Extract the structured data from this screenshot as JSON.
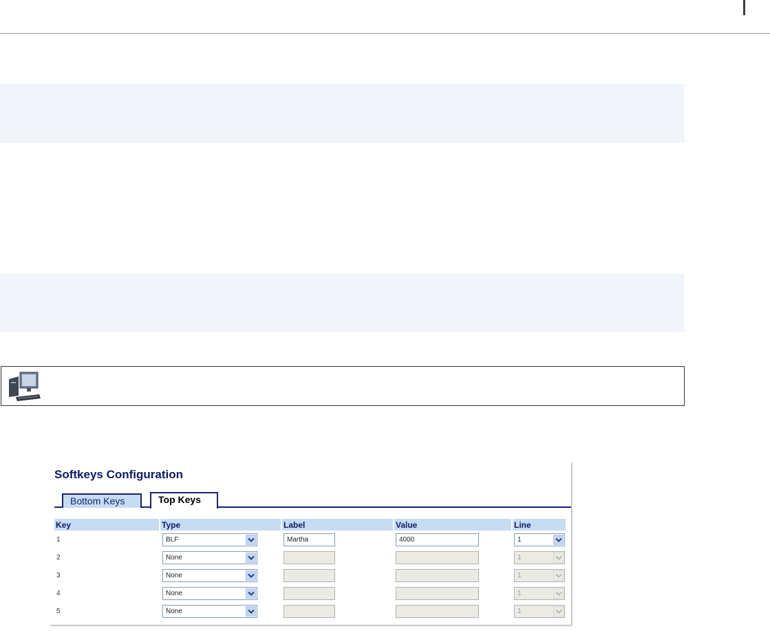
{
  "panel": {
    "title": "Softkeys Configuration",
    "tabs": [
      {
        "label": "Bottom Keys",
        "active": false
      },
      {
        "label": "Top Keys",
        "active": true
      }
    ],
    "columns": [
      "Key",
      "Type",
      "Label",
      "Value",
      "Line"
    ],
    "rows": [
      {
        "key": "1",
        "type": "BLF",
        "label": "Martha",
        "value": "4000",
        "line": "1",
        "enabled": true
      },
      {
        "key": "2",
        "type": "None",
        "label": "",
        "value": "",
        "line": "1",
        "enabled": false
      },
      {
        "key": "3",
        "type": "None",
        "label": "",
        "value": "",
        "line": "1",
        "enabled": false
      },
      {
        "key": "4",
        "type": "None",
        "label": "",
        "value": "",
        "line": "1",
        "enabled": false
      },
      {
        "key": "5",
        "type": "None",
        "label": "",
        "value": "",
        "line": "1",
        "enabled": false
      }
    ]
  },
  "colors": {
    "header_blue": "#c6dcf2",
    "title_navy": "#0c1a66",
    "band": "#f1f4fa"
  },
  "icons": {
    "web_ui": "computer-monitor-icon",
    "dropdown": "chevron-down-icon"
  }
}
